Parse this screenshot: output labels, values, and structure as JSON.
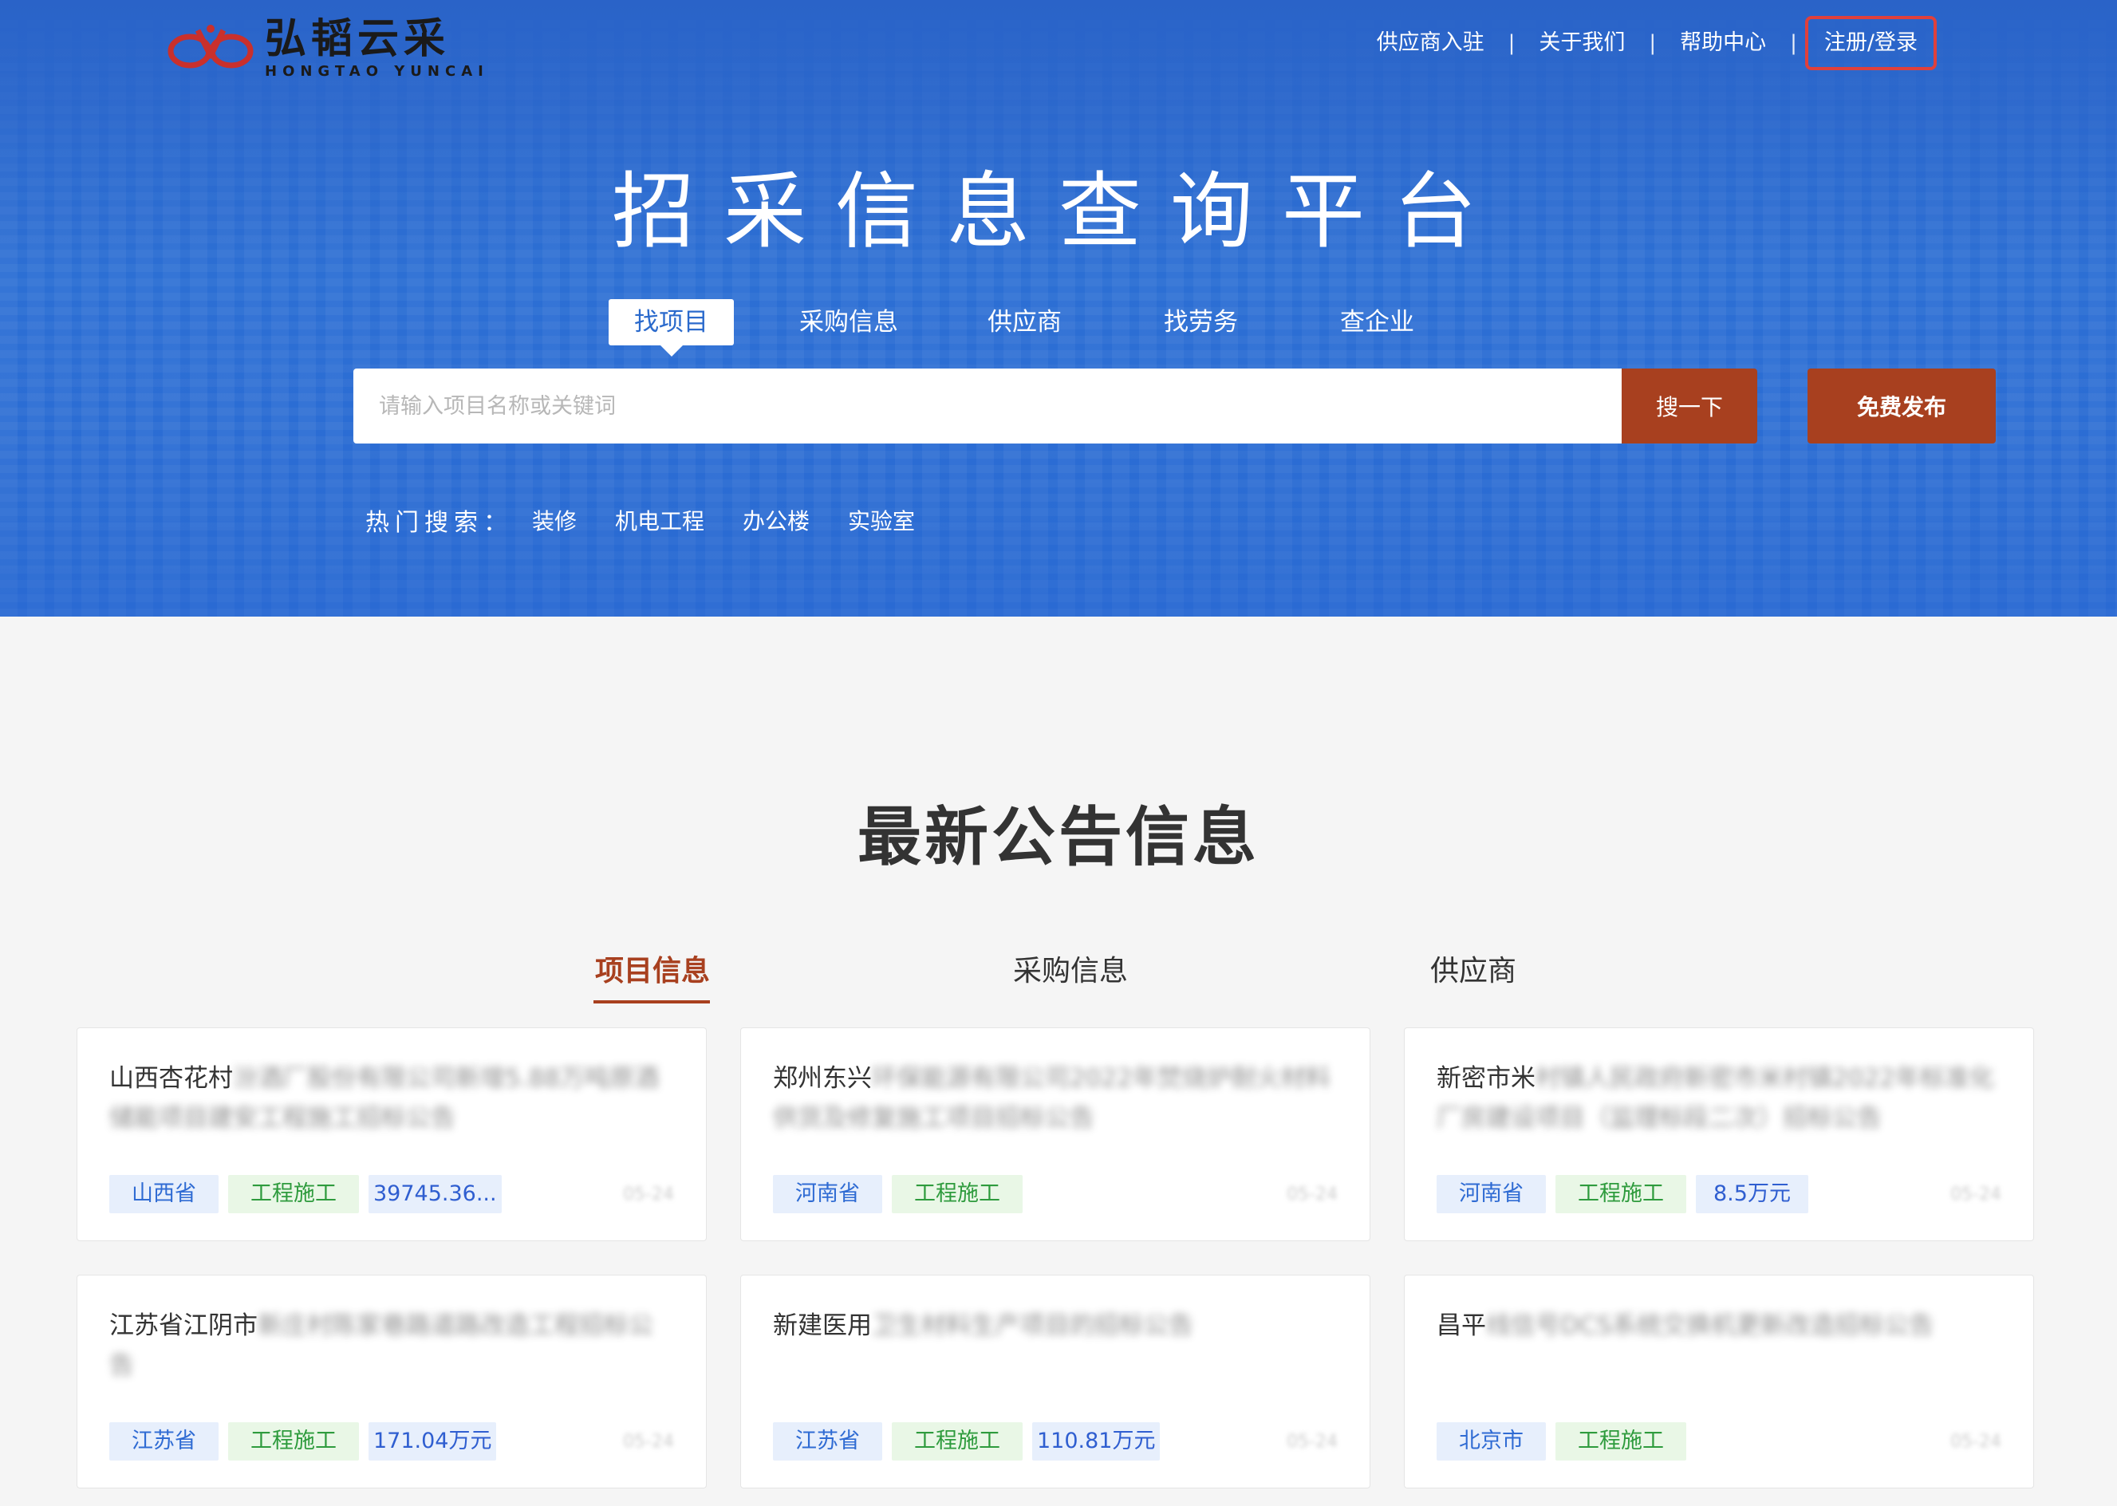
{
  "logo": {
    "cn": "弘韬云采",
    "en": "HONGTAO YUNCAI"
  },
  "topnav": {
    "supplier": "供应商入驻",
    "about": "关于我们",
    "help": "帮助中心",
    "login": "注册/登录",
    "sep": "|"
  },
  "hero": {
    "title": "招采信息查询平台",
    "tabs": [
      "找项目",
      "采购信息",
      "供应商",
      "找劳务",
      "查企业"
    ],
    "search_placeholder": "请输入项目名称或关键词",
    "search_button": "搜一下",
    "publish_button": "免费发布",
    "hot_label": "热门搜索：",
    "hot_items": [
      "装修",
      "机电工程",
      "办公楼",
      "实验室"
    ]
  },
  "section": {
    "title": "最新公告信息",
    "tabs": [
      "项目信息",
      "采购信息",
      "供应商"
    ]
  },
  "cards": [
    {
      "title_clear": "山西杏花村",
      "title_blur": "汾酒厂股份有限公司新增5.88万吨原酒储能项目建安工程施工招标公告",
      "region": "山西省",
      "type": "工程施工",
      "amount": "39745.36...",
      "date": "05-24"
    },
    {
      "title_clear": "郑州东兴",
      "title_blur": "环保能源有限公司2022年焚烧炉耐火材料供货及修复施工项目招标公告",
      "region": "河南省",
      "type": "工程施工",
      "amount": "",
      "date": "05-24"
    },
    {
      "title_clear": "新密市米",
      "title_blur": "村镇人民政府新密市米村镇2022年标准化厂房建设项目（监理标段二次）招标公告",
      "region": "河南省",
      "type": "工程施工",
      "amount": "8.5万元",
      "date": "05-24"
    },
    {
      "title_clear": "江苏省江阴市",
      "title_blur": "新庄村陈家巷路道路改造工程招标公告",
      "region": "江苏省",
      "type": "工程施工",
      "amount": "171.04万元",
      "date": "05-24"
    },
    {
      "title_clear": "新建医用",
      "title_blur": "卫生材料生产项目的招标公告",
      "region": "江苏省",
      "type": "工程施工",
      "amount": "110.81万元",
      "date": "05-24"
    },
    {
      "title_clear": "昌平",
      "title_blur": "线信号DCS系统交换机更新改造招标公告",
      "region": "北京市",
      "type": "工程施工",
      "amount": "",
      "date": "05-24"
    }
  ],
  "colors": {
    "primary_blue": "#2b6acc",
    "accent_red": "#a8401f",
    "login_border": "#e0403b"
  }
}
